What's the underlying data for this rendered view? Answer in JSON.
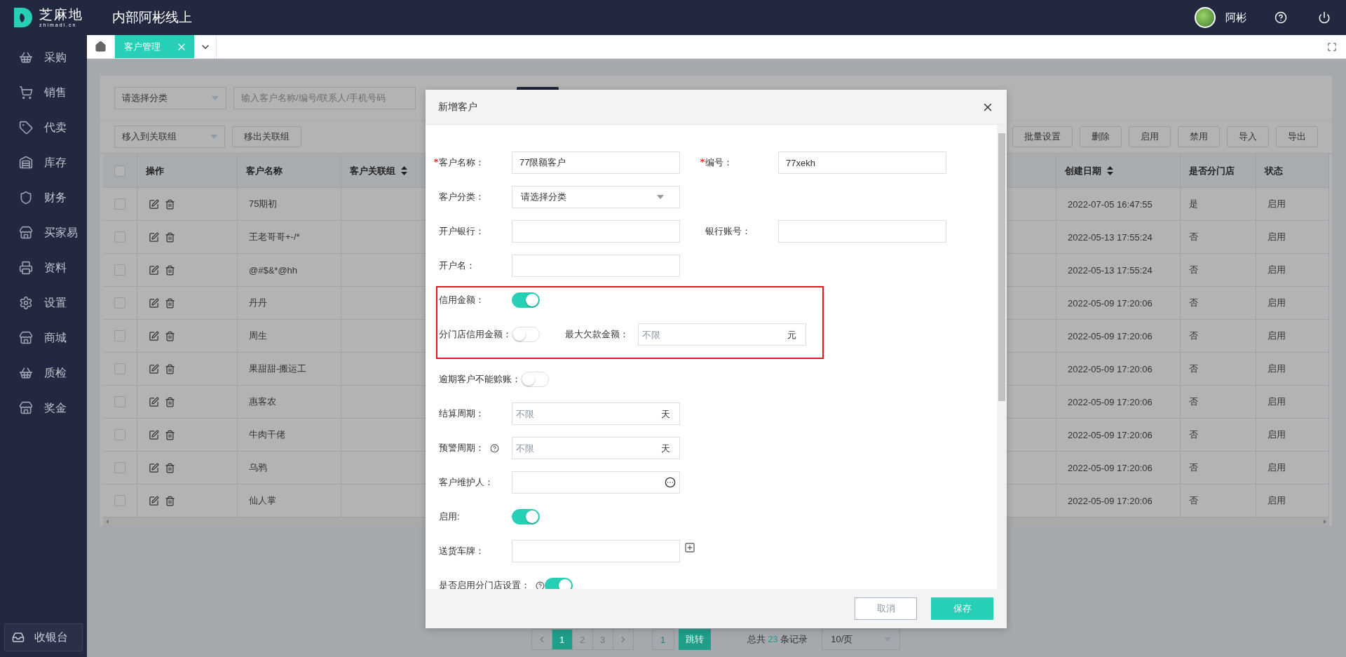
{
  "header": {
    "logo_name": "芝麻地",
    "logo_domain": "zhimadi.cn",
    "title": "内部阿彬线上",
    "user_name": "阿彬"
  },
  "sidebar": {
    "items": [
      {
        "label": "采购"
      },
      {
        "label": "销售"
      },
      {
        "label": "代卖"
      },
      {
        "label": "库存"
      },
      {
        "label": "财务"
      },
      {
        "label": "买家易"
      },
      {
        "label": "资料"
      },
      {
        "label": "设置"
      },
      {
        "label": "商城"
      },
      {
        "label": "质检"
      },
      {
        "label": "奖金"
      }
    ],
    "cashier": "收银台"
  },
  "tabs": [
    {
      "label": "客户管理",
      "selected": true
    }
  ],
  "filters": {
    "category": "请选择分类",
    "search_placeholder": "输入客户名称/编号/联系人/手机号码"
  },
  "actions": {
    "group_select": "移入到关联组",
    "group_remove": "移出关联组",
    "buttons": [
      "批量设置",
      "删除",
      "启用",
      "禁用",
      "导入",
      "导出"
    ]
  },
  "table": {
    "all_checked": false,
    "columns": [
      {
        "label": "操作",
        "sortable": false
      },
      {
        "label": "客户名称",
        "sortable": false
      },
      {
        "label": "客户关联组",
        "sortable": true
      },
      {
        "label": "创建日期",
        "sortable": true
      },
      {
        "label": "是否分门店",
        "sortable": false
      },
      {
        "label": "状态",
        "sortable": false
      }
    ],
    "rows": [
      {
        "checked": false,
        "name": "75期初",
        "created": "2022-07-05 16:47:55",
        "branch": "是",
        "status": "启用"
      },
      {
        "checked": false,
        "name": "王老哥哥+-/*",
        "created": "2022-05-13 17:55:24",
        "branch": "否",
        "status": "启用"
      },
      {
        "checked": false,
        "name": "@#$&*@hh",
        "created": "2022-05-13 17:55:24",
        "branch": "否",
        "status": "启用"
      },
      {
        "checked": false,
        "name": "丹丹",
        "created": "2022-05-09 17:20:06",
        "branch": "否",
        "status": "启用"
      },
      {
        "checked": false,
        "name": "周生",
        "created": "2022-05-09 17:20:06",
        "branch": "否",
        "status": "启用"
      },
      {
        "checked": false,
        "name": "果甜甜-搬运工",
        "created": "2022-05-09 17:20:06",
        "branch": "否",
        "status": "启用"
      },
      {
        "checked": false,
        "name": "惠客农",
        "created": "2022-05-09 17:20:06",
        "branch": "否",
        "status": "启用"
      },
      {
        "checked": false,
        "name": "牛肉干佬",
        "created": "2022-05-09 17:20:06",
        "branch": "否",
        "status": "启用"
      },
      {
        "checked": false,
        "name": "乌鸦",
        "created": "2022-05-09 17:20:06",
        "branch": "否",
        "status": "启用"
      },
      {
        "checked": false,
        "name": "仙人掌",
        "created": "2022-05-09 17:20:06",
        "branch": "否",
        "status": "启用"
      }
    ]
  },
  "pagination": {
    "pages": [
      {
        "label": "1",
        "selected": true
      },
      {
        "label": "2",
        "selected": false
      },
      {
        "label": "3",
        "selected": false
      }
    ],
    "jump_value": "1",
    "jump_button": "跳转",
    "total_prefix": "总共",
    "total": "23",
    "total_suffix": "条记录",
    "page_size": "10/页"
  },
  "dialog": {
    "title": "新增客户",
    "sections": [
      {
        "highlighted": false,
        "rows": [
          [
            {
              "kind": "text",
              "label": "客户名称：",
              "required": true,
              "help": false,
              "value": "77限额客户"
            },
            {
              "kind": "text",
              "label": "编号：",
              "required": true,
              "help": false,
              "value": "77xekh"
            }
          ],
          [
            {
              "kind": "select",
              "label": "客户分类：",
              "required": false,
              "help": false,
              "value": "请选择分类"
            }
          ],
          [
            {
              "kind": "text",
              "label": "开户银行：",
              "required": false,
              "help": false
            },
            {
              "kind": "text",
              "label": "银行账号：",
              "required": false,
              "help": false
            }
          ],
          [
            {
              "kind": "text",
              "label": "开户名：",
              "required": false,
              "help": false
            }
          ]
        ]
      },
      {
        "highlighted": true,
        "rows": [
          [
            {
              "kind": "switch",
              "label": "信用金额：",
              "required": false,
              "help": false,
              "on": true
            }
          ],
          [
            {
              "kind": "switch",
              "label": "分门店信用金额：",
              "required": false,
              "help": false,
              "on": false
            },
            {
              "kind": "unit",
              "label": "最大欠款金额：",
              "required": false,
              "help": false,
              "placeholder": "不限",
              "unit": "元"
            }
          ]
        ]
      },
      {
        "highlighted": false,
        "rows": [
          [
            {
              "kind": "switch",
              "label": "逾期客户不能赊账：",
              "required": false,
              "help": false,
              "on": false
            }
          ],
          [
            {
              "kind": "unit",
              "label": "结算周期：",
              "required": false,
              "help": false,
              "placeholder": "不限",
              "unit": "天"
            }
          ],
          [
            {
              "kind": "unit",
              "label": "预警周期：",
              "required": false,
              "help": true,
              "placeholder": "不限",
              "unit": "天"
            }
          ],
          [
            {
              "kind": "picker",
              "label": "客户维护人：",
              "required": false,
              "help": false
            }
          ],
          [
            {
              "kind": "switch",
              "label": "启用:",
              "required": false,
              "help": false,
              "on": true
            }
          ],
          [
            {
              "kind": "plate",
              "label": "送货车牌：",
              "required": false,
              "help": false
            }
          ],
          [
            {
              "kind": "switch",
              "label": "是否启用分门店设置：",
              "required": false,
              "help": true,
              "on": true
            }
          ]
        ]
      }
    ],
    "buttons": [
      {
        "label": "取消",
        "kind": "secondary"
      },
      {
        "label": "保存",
        "kind": "primary"
      }
    ]
  }
}
